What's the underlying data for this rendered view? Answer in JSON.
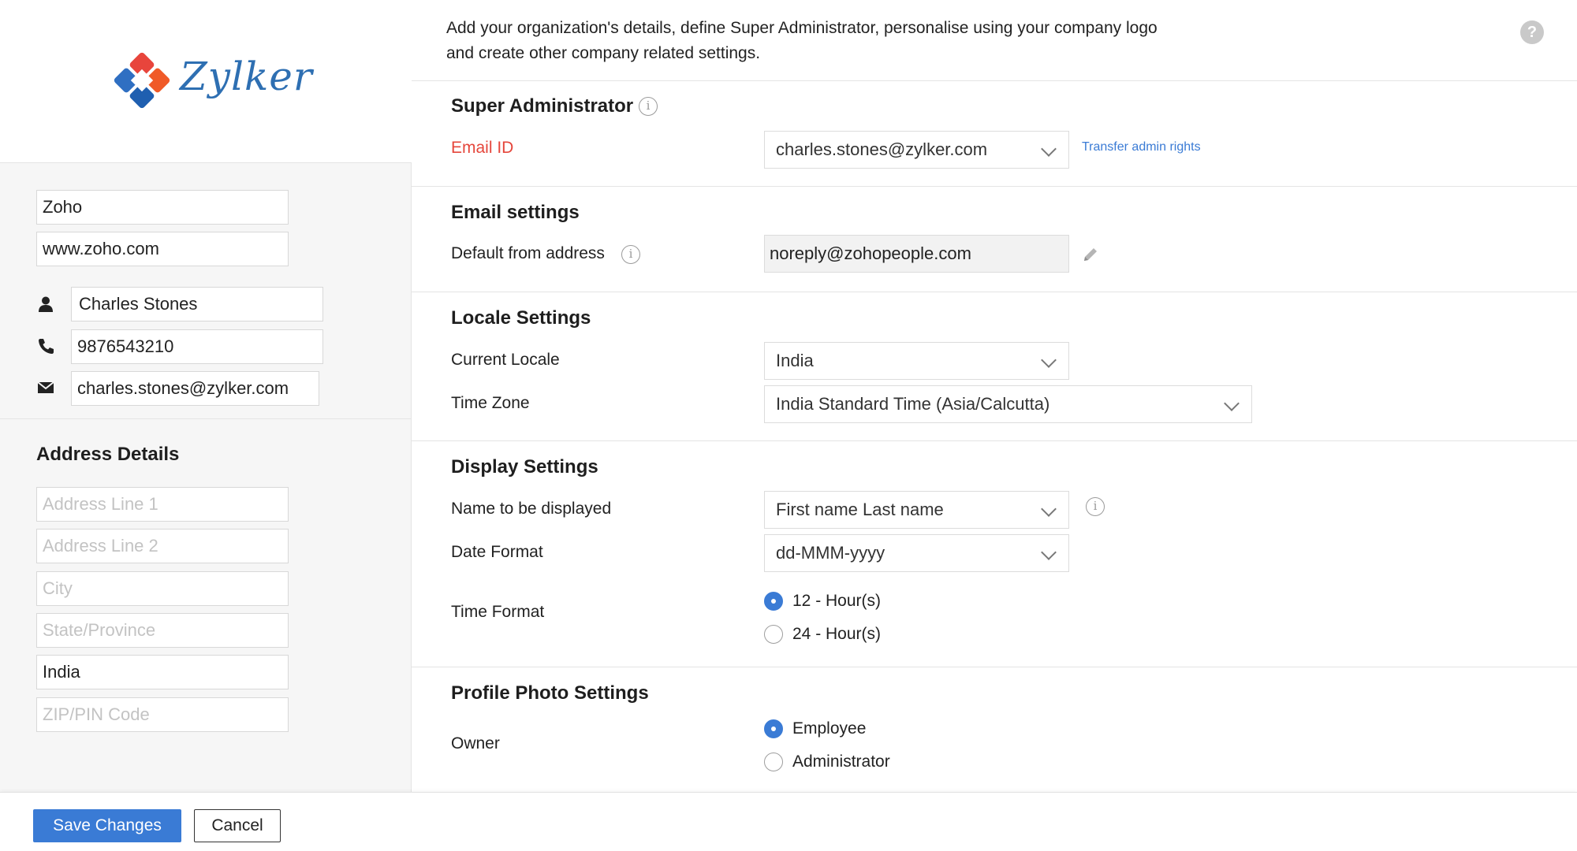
{
  "intro_text": "Add your organization's details, define Super Administrator, personalise using your company logo and create other company related settings.",
  "help_label": "?",
  "logo": {
    "text": "Zylker"
  },
  "organization": {
    "name": "Zoho",
    "website": "www.zoho.com"
  },
  "contact": {
    "name": "Charles Stones",
    "phone": "9876543210",
    "email": "charles.stones@zylker.com"
  },
  "address": {
    "title": "Address Details",
    "line1_placeholder": "Address Line 1",
    "line2_placeholder": "Address Line 2",
    "city_placeholder": "City",
    "state_placeholder": "State/Province",
    "country": "India",
    "zip_placeholder": "ZIP/PIN Code"
  },
  "super_admin": {
    "title": "Super Administrator",
    "email_label": "Email ID",
    "email_value": "charles.stones@zylker.com",
    "transfer_link": "Transfer admin rights"
  },
  "email_settings": {
    "title": "Email settings",
    "from_label": "Default from address",
    "from_value": "noreply@zohopeople.com"
  },
  "locale": {
    "title": "Locale Settings",
    "locale_label": "Current Locale",
    "locale_value": "India",
    "timezone_label": "Time Zone",
    "timezone_value": "India Standard Time (Asia/Calcutta)"
  },
  "display": {
    "title": "Display Settings",
    "name_label": "Name to be displayed",
    "name_value": "First name Last name",
    "date_label": "Date Format",
    "date_value": "dd-MMM-yyyy",
    "time_label": "Time Format",
    "time_options": [
      "12 - Hour(s)",
      "24 - Hour(s)"
    ]
  },
  "profile_photo": {
    "title": "Profile Photo Settings",
    "owner_label": "Owner",
    "owner_options": [
      "Employee",
      "Administrator"
    ]
  },
  "footer": {
    "save_label": "Save Changes",
    "cancel_label": "Cancel"
  },
  "colors": {
    "accent": "#3a7bd5",
    "required_label": "#e5463b"
  }
}
